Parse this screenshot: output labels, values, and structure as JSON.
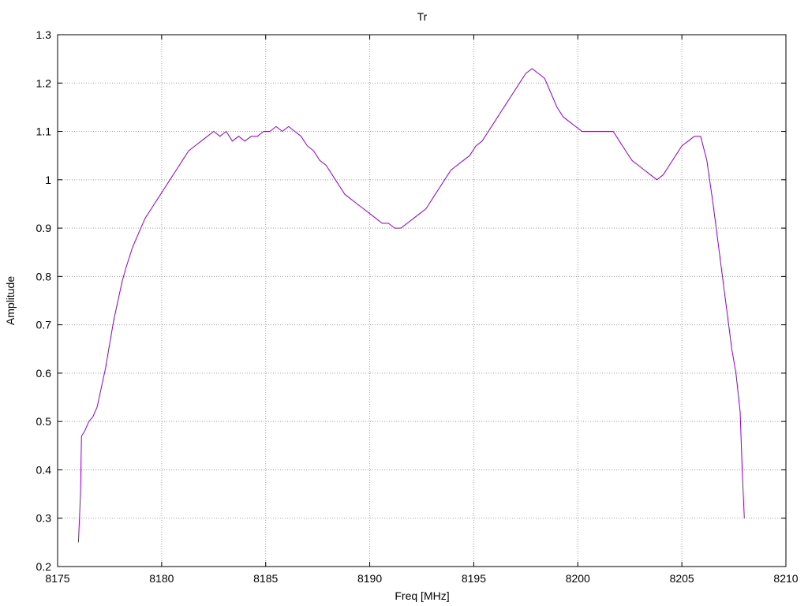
{
  "chart_data": {
    "type": "line",
    "title": "Tr",
    "xlabel": "Freq [MHz]",
    "ylabel": "Amplitude",
    "xlim": [
      8175,
      8210
    ],
    "ylim": [
      0.2,
      1.3
    ],
    "x_ticks": [
      8175,
      8180,
      8185,
      8190,
      8195,
      8200,
      8205,
      8210
    ],
    "y_ticks": [
      0.2,
      0.3,
      0.4,
      0.5,
      0.6,
      0.7,
      0.8,
      0.9,
      1,
      1.1,
      1.2,
      1.3
    ],
    "grid": true,
    "line_color": "#9400d3",
    "series": [
      {
        "x": [
          8176.0,
          8176.1,
          8176.15,
          8176.3,
          8176.5,
          8176.7,
          8176.9,
          8177.1,
          8177.3,
          8177.5,
          8177.7,
          8177.9,
          8178.1,
          8178.3,
          8178.6,
          8178.9,
          8179.2,
          8179.5,
          8179.8,
          8180.1,
          8180.4,
          8180.7,
          8181.0,
          8181.3,
          8181.6,
          8181.9,
          8182.2,
          8182.5,
          8182.8,
          8183.1,
          8183.4,
          8183.7,
          8184.0,
          8184.3,
          8184.6,
          8184.9,
          8185.2,
          8185.5,
          8185.8,
          8186.1,
          8186.4,
          8186.7,
          8187.0,
          8187.3,
          8187.6,
          8187.9,
          8188.2,
          8188.5,
          8188.8,
          8189.1,
          8189.4,
          8189.7,
          8190.0,
          8190.3,
          8190.6,
          8190.9,
          8191.2,
          8191.5,
          8191.8,
          8192.1,
          8192.4,
          8192.7,
          8193.0,
          8193.3,
          8193.6,
          8193.9,
          8194.2,
          8194.5,
          8194.8,
          8195.1,
          8195.4,
          8195.7,
          8196.0,
          8196.3,
          8196.6,
          8196.9,
          8197.2,
          8197.5,
          8197.8,
          8198.1,
          8198.4,
          8198.7,
          8199.0,
          8199.3,
          8199.6,
          8199.9,
          8200.2,
          8200.5,
          8200.8,
          8201.1,
          8201.4,
          8201.7,
          8202.0,
          8202.3,
          8202.6,
          8202.9,
          8203.2,
          8203.5,
          8203.8,
          8204.1,
          8204.4,
          8204.7,
          8205.0,
          8205.3,
          8205.6,
          8205.9,
          8206.2,
          8206.5,
          8206.8,
          8207.1,
          8207.4,
          8207.6,
          8207.8,
          8207.9,
          8208.0
        ],
        "y": [
          0.25,
          0.35,
          0.47,
          0.48,
          0.5,
          0.51,
          0.53,
          0.57,
          0.61,
          0.66,
          0.71,
          0.75,
          0.79,
          0.82,
          0.86,
          0.89,
          0.92,
          0.94,
          0.96,
          0.98,
          1.0,
          1.02,
          1.04,
          1.06,
          1.07,
          1.08,
          1.09,
          1.1,
          1.09,
          1.1,
          1.08,
          1.09,
          1.08,
          1.09,
          1.09,
          1.1,
          1.1,
          1.11,
          1.1,
          1.11,
          1.1,
          1.09,
          1.07,
          1.06,
          1.04,
          1.03,
          1.01,
          0.99,
          0.97,
          0.96,
          0.95,
          0.94,
          0.93,
          0.92,
          0.91,
          0.91,
          0.9,
          0.9,
          0.91,
          0.92,
          0.93,
          0.94,
          0.96,
          0.98,
          1.0,
          1.02,
          1.03,
          1.04,
          1.05,
          1.07,
          1.08,
          1.1,
          1.12,
          1.14,
          1.16,
          1.18,
          1.2,
          1.22,
          1.23,
          1.22,
          1.21,
          1.18,
          1.15,
          1.13,
          1.12,
          1.11,
          1.1,
          1.1,
          1.1,
          1.1,
          1.1,
          1.1,
          1.08,
          1.06,
          1.04,
          1.03,
          1.02,
          1.01,
          1.0,
          1.01,
          1.03,
          1.05,
          1.07,
          1.08,
          1.09,
          1.09,
          1.04,
          0.95,
          0.85,
          0.75,
          0.65,
          0.6,
          0.52,
          0.4,
          0.3
        ]
      }
    ]
  }
}
